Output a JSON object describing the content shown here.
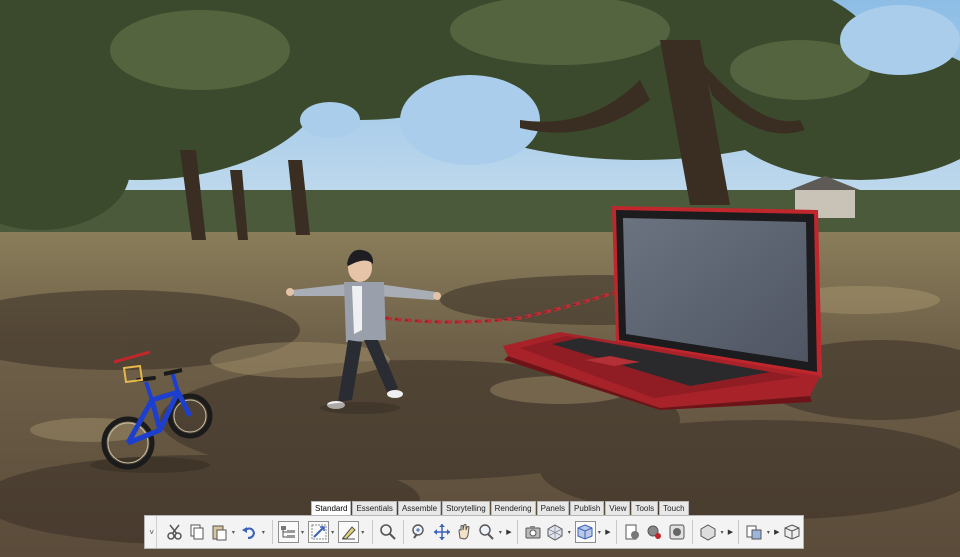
{
  "ribbon": {
    "tabs": [
      "Standard",
      "Essentials",
      "Assemble",
      "Storytelling",
      "Rendering",
      "Panels",
      "Publish",
      "View",
      "Tools",
      "Touch"
    ],
    "active_tab": "Standard",
    "collapse_glyph": "˅",
    "more_glyph": "▶",
    "dropdown_glyph": "▾"
  },
  "toolbar": {
    "tools": [
      "cut-icon",
      "copy-icon",
      "paste-icon",
      "undo-icon",
      "select-icon",
      "transform-icon",
      "measure-icon",
      "search-icon",
      "zoom-icon",
      "pan-icon",
      "hand-icon",
      "lens-icon",
      "camera-icon",
      "component-icon",
      "view-cube-icon",
      "render-icon",
      "settings-icon",
      "material-icon",
      "geometry-icon",
      "publish-icon",
      "export-icon"
    ]
  },
  "colors": {
    "sky": "#9ec8ea",
    "ground": "#6b5b45",
    "laptop_shell": "#c0272d",
    "screen": "#5f6672",
    "chain": "#b53036",
    "bike_frame": "#1d3fcf",
    "toolbar_bg": "#f3f3f3"
  }
}
